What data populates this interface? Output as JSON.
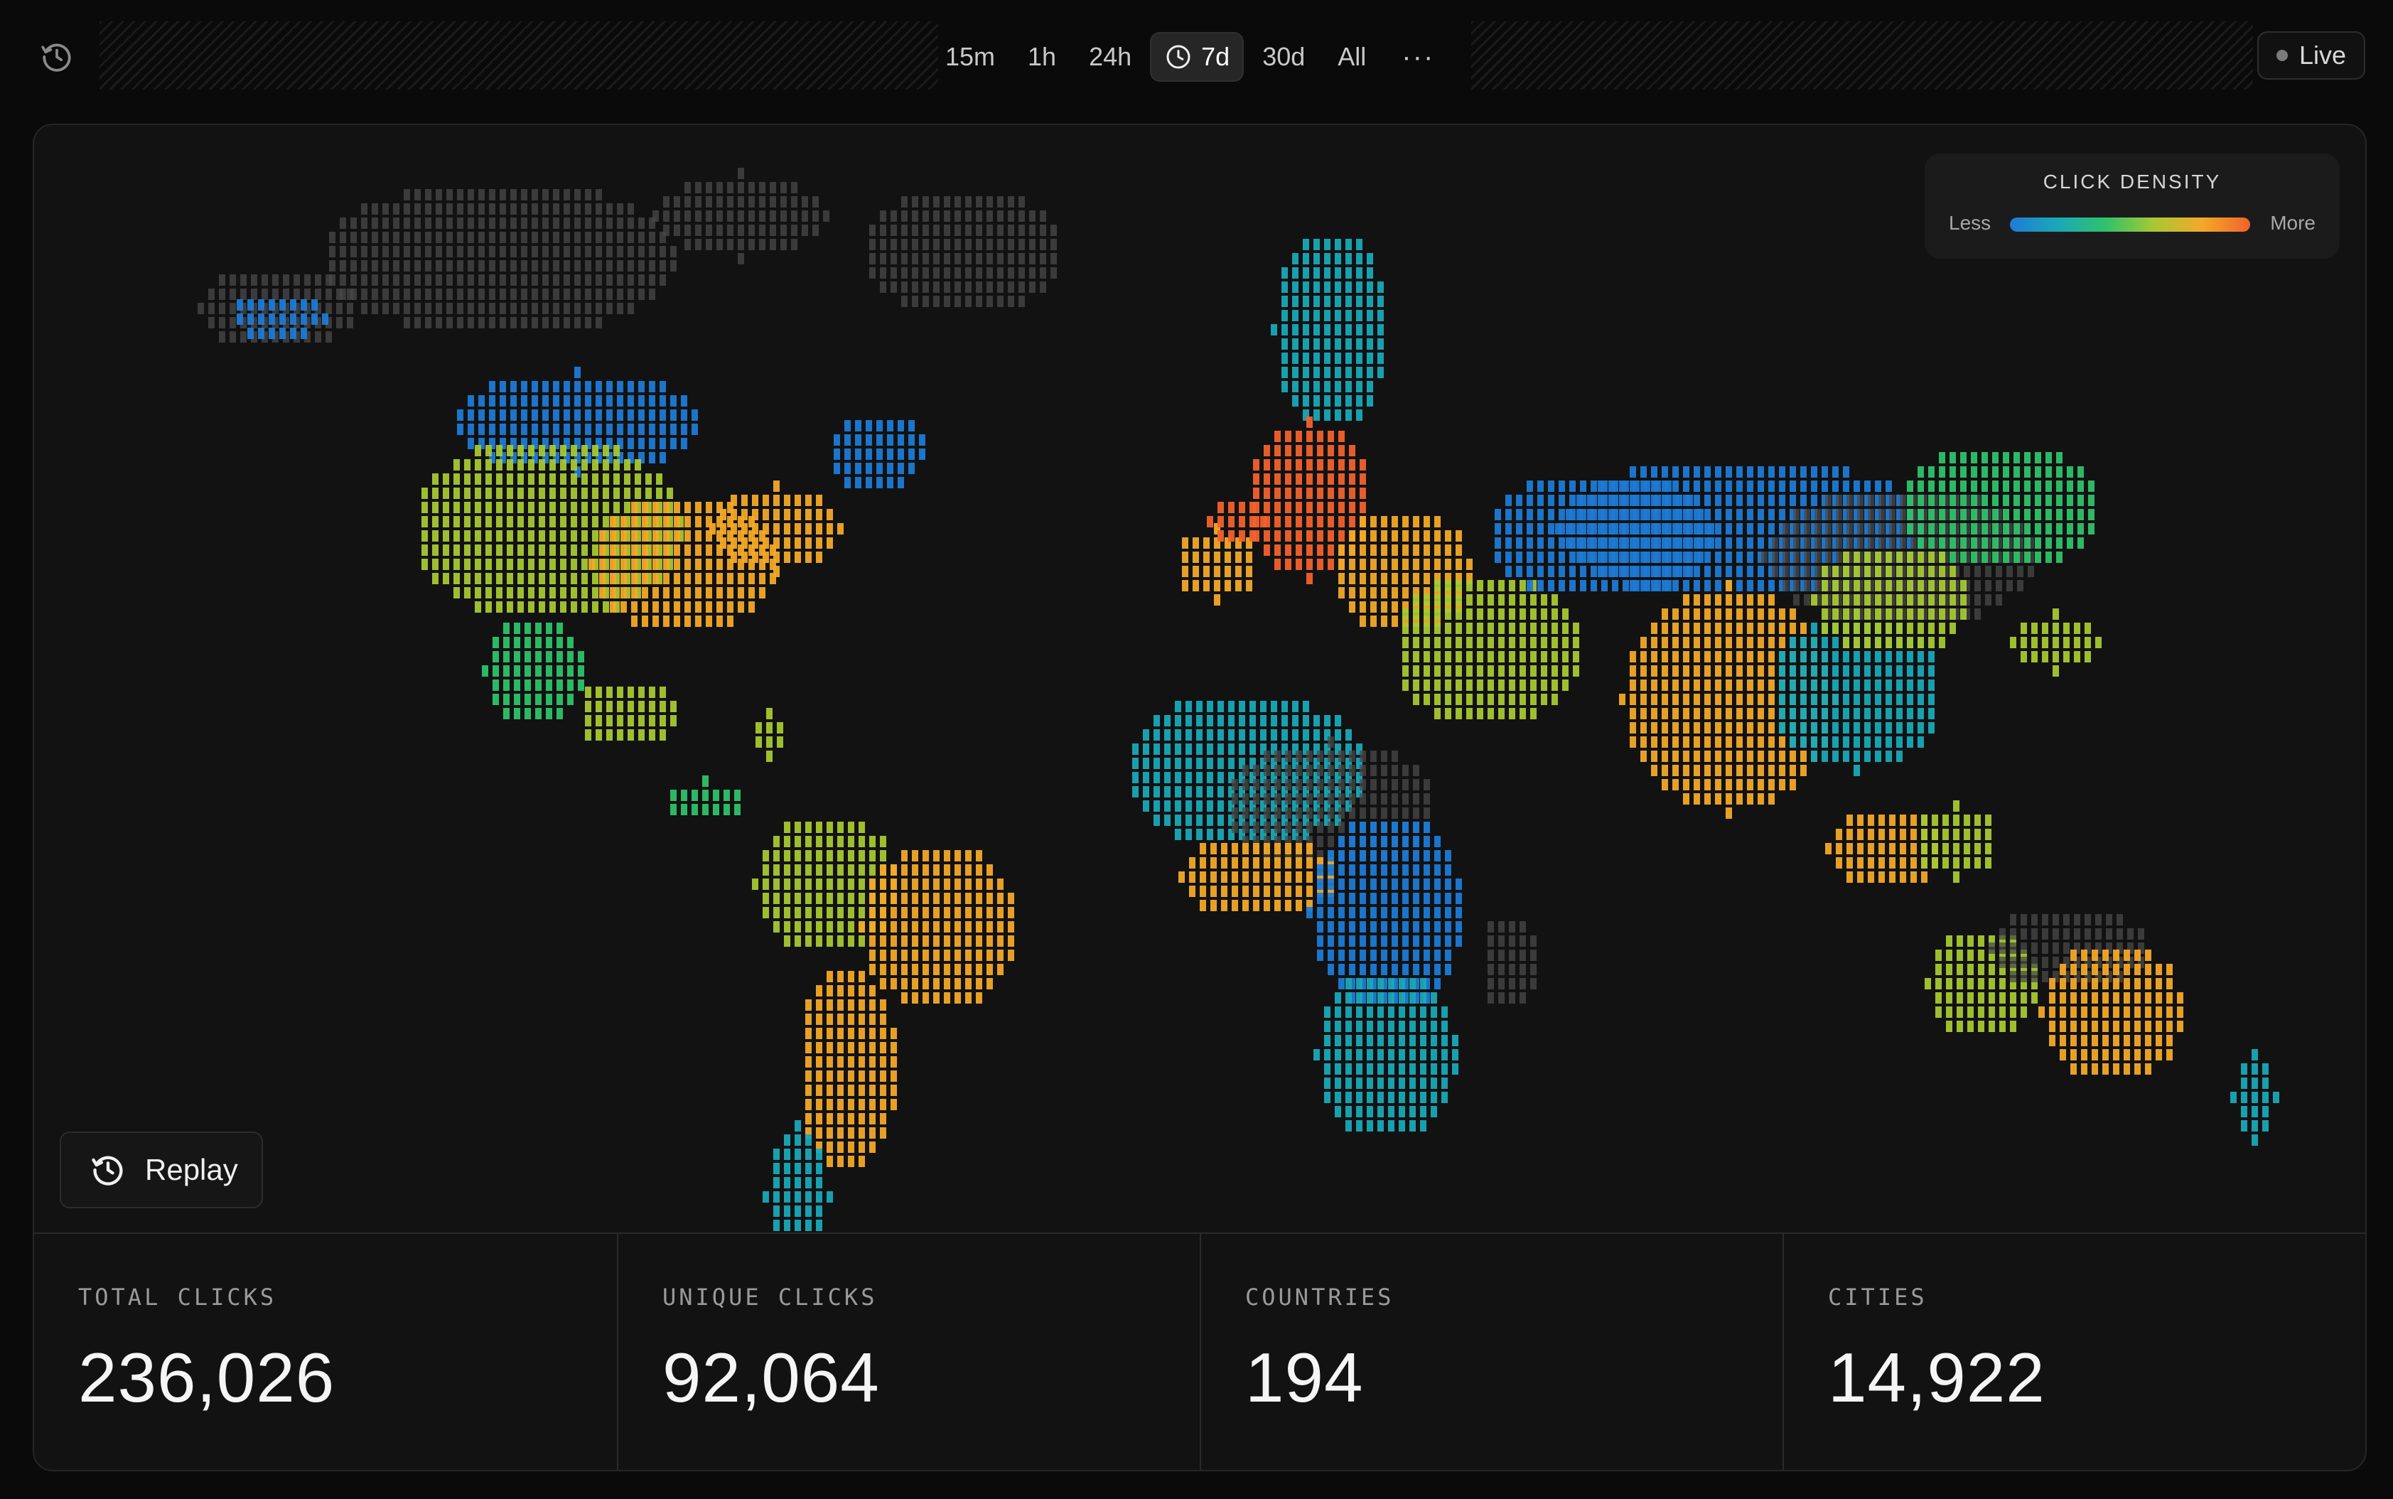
{
  "toolbar": {
    "history_icon": "history-clock-icon",
    "ranges": [
      {
        "label": "15m",
        "active": false
      },
      {
        "label": "1h",
        "active": false
      },
      {
        "label": "24h",
        "active": false
      },
      {
        "label": "7d",
        "active": true,
        "icon": "clock-icon"
      },
      {
        "label": "30d",
        "active": false
      },
      {
        "label": "All",
        "active": false
      }
    ],
    "more_label": "···",
    "live_label": "Live"
  },
  "map": {
    "legend": {
      "title": "CLICK DENSITY",
      "less": "Less",
      "more": "More"
    },
    "density_colors": [
      "#1e7bd6",
      "#1aa9b8",
      "#2fc26a",
      "#a8c832",
      "#f3a928",
      "#f2622d"
    ],
    "no_data_color": "#4a4a4a",
    "replay_label": "Replay"
  },
  "stats": [
    {
      "label": "TOTAL CLICKS",
      "value": "236,026"
    },
    {
      "label": "UNIQUE CLICKS",
      "value": "92,064"
    },
    {
      "label": "COUNTRIES",
      "value": "194"
    },
    {
      "label": "CITIES",
      "value": "14,922"
    }
  ]
}
